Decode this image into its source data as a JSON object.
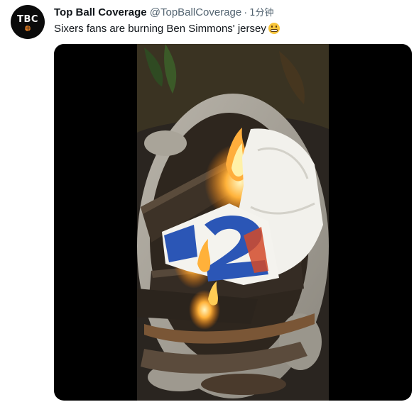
{
  "tweet": {
    "avatar_text": "TBC",
    "display_name": "Top Ball Coverage",
    "handle": "@TopBallCoverage",
    "separator": "·",
    "time": "1分钟",
    "text": "Sixers fans are burning Ben Simmons' jersey"
  },
  "icons": {
    "avatar_ball": "basketball-icon",
    "text_emoji": "grimacing-face-emoji"
  },
  "colors": {
    "text_primary": "#0f1419",
    "text_secondary": "#536471",
    "media_background": "#000000"
  }
}
